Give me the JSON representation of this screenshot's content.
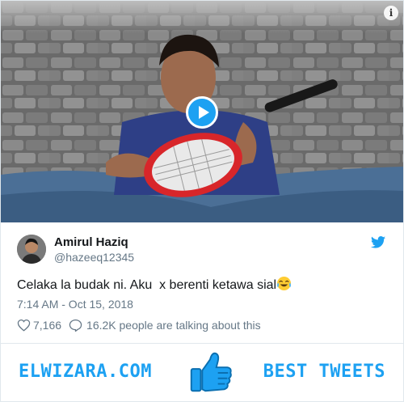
{
  "tweet": {
    "author_name": "Amirul Haziq",
    "author_handle": "@hazeeq12345",
    "text": "Celaka la budak ni. Aku  x berenti ketawa sial",
    "emoji": "face-with-tears-of-joy",
    "timestamp": "7:14 AM - Oct 15, 2018",
    "likes": "7,166",
    "talking": "16.2K people are talking about this"
  },
  "video": {
    "info_label": "i",
    "play_icon": "play-icon"
  },
  "icons": {
    "twitter": "twitter-bird-icon",
    "heart": "heart-icon",
    "reply": "reply-bubble-icon",
    "thumb": "thumbs-up-icon"
  },
  "banner": {
    "brand": "ELWIZARA.COM",
    "tagline": "BEST TWEETS"
  },
  "colors": {
    "accent": "#1da1f2",
    "text": "#14171a",
    "muted": "#657786",
    "border": "#e1e8ed"
  }
}
